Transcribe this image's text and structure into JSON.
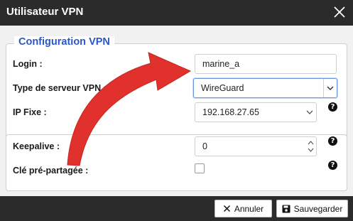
{
  "dialog": {
    "title": "Utilisateur VPN",
    "close_icon": "close-icon"
  },
  "section1": {
    "legend": "Configuration VPN",
    "login_label": "Login :",
    "login_value": "marine_a",
    "server_type_label": "Type de serveur VPN :",
    "server_type_value": "WireGuard",
    "fixed_ip_label": "IP Fixe :",
    "fixed_ip_value": "192.168.27.65"
  },
  "section2": {
    "keepalive_label": "Keepalive :",
    "keepalive_value": "0",
    "psk_label": "Clé pré-partagée :",
    "psk_checked": false
  },
  "help_icon_glyph": "?",
  "footer": {
    "cancel_label": "Annuler",
    "save_label": "Sauvegarder",
    "cancel_icon": "x-icon",
    "save_icon": "floppy-disk-icon"
  },
  "colors": {
    "accent": "#2a56c6",
    "titlebar": "#2b2b2b",
    "annotation_arrow": "#e0312c"
  }
}
